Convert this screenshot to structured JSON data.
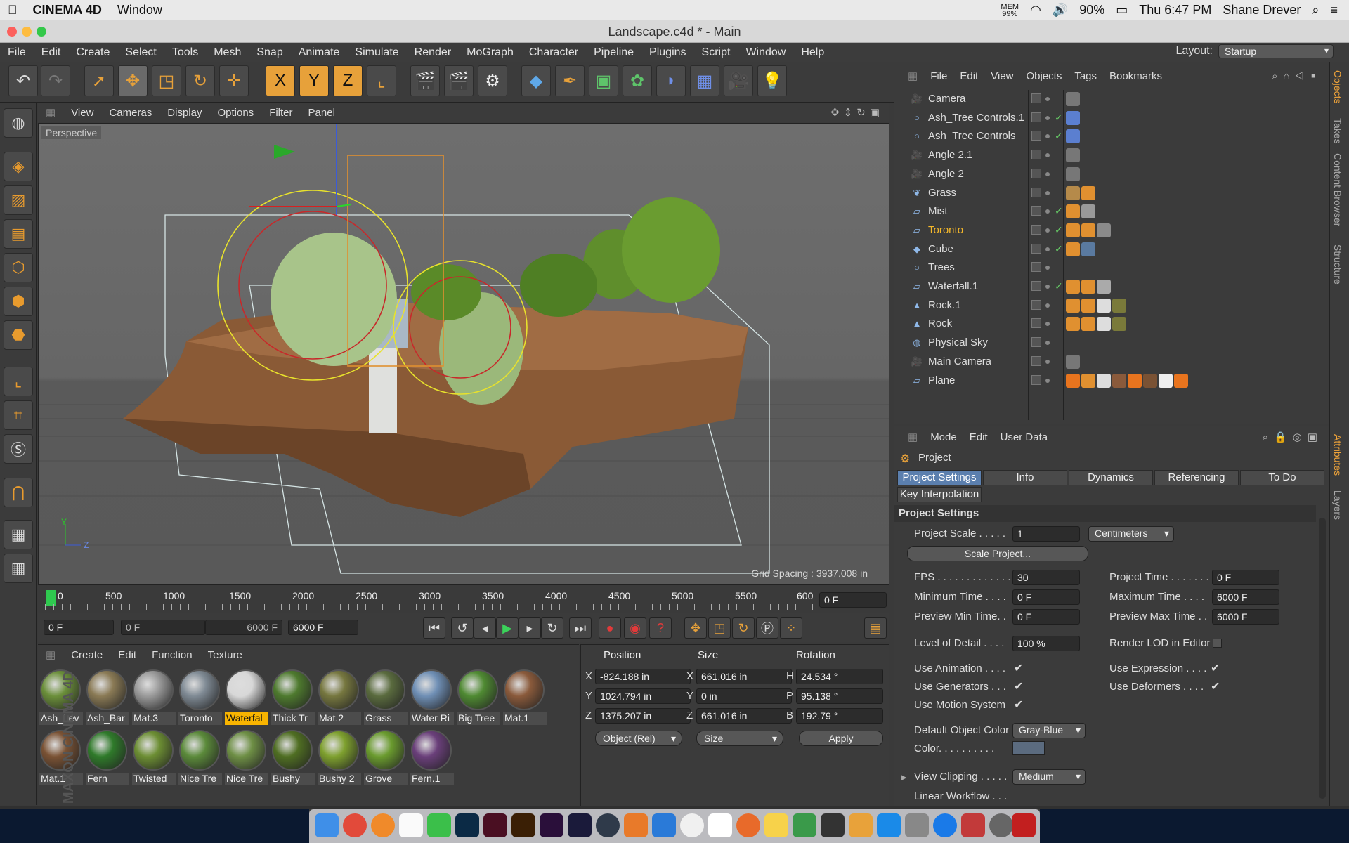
{
  "mac": {
    "app": "CINEMA 4D",
    "menu": [
      "Window"
    ],
    "mem": "MEM",
    "mem_value": "99%",
    "battery": "90%",
    "clock": "Thu 6:47 PM",
    "user": "Shane Drever"
  },
  "window": {
    "title": "Landscape.c4d * - Main"
  },
  "appmenu": {
    "items": [
      "File",
      "Edit",
      "Create",
      "Select",
      "Tools",
      "Mesh",
      "Snap",
      "Animate",
      "Simulate",
      "Render",
      "MoGraph",
      "Character",
      "Pipeline",
      "Plugins",
      "Script",
      "Window",
      "Help"
    ],
    "layout_label": "Layout:",
    "layout_value": "Startup"
  },
  "toolbar": {
    "tools": [
      "undo-icon",
      "redo-icon",
      "select-live-icon",
      "move-icon",
      "scale-icon",
      "rotate-icon",
      "transform-icon",
      "x-axis-icon",
      "y-axis-icon",
      "z-axis-icon",
      "world-coords-icon",
      "render-view-icon",
      "render-picture-viewer-icon",
      "render-settings-icon",
      "cube-icon",
      "pen-icon",
      "subdivision-icon",
      "cloner-icon",
      "deformer-icon",
      "floor-icon",
      "camera-icon",
      "light-icon"
    ],
    "axis_labels": [
      "X",
      "Y",
      "Z"
    ]
  },
  "viewport": {
    "menu": [
      "View",
      "Cameras",
      "Display",
      "Options",
      "Filter",
      "Panel"
    ],
    "label": "Perspective",
    "grid_spacing": "Grid Spacing : 3937.008 in",
    "axis_y": "Y",
    "axis_z": "Z"
  },
  "timeline": {
    "ticks": [
      "0",
      "500",
      "1000",
      "1500",
      "2000",
      "2500",
      "3000",
      "3500",
      "4000",
      "4500",
      "5000",
      "5500",
      "600"
    ],
    "current_frame": "0 F",
    "start": "0 F",
    "range_start": "0 F",
    "range_end": "6000 F",
    "end": "6000 F"
  },
  "materials": {
    "menu": [
      "Create",
      "Edit",
      "Function",
      "Texture"
    ],
    "items": [
      {
        "label": "Ash_Lev",
        "color": "#6b8f3a"
      },
      {
        "label": "Ash_Bar",
        "color": "#8a7a55"
      },
      {
        "label": "Mat.3",
        "color": "#9a9a9a"
      },
      {
        "label": "Toronto",
        "color": "#7f8a94"
      },
      {
        "label": "Waterfal",
        "color": "#d8d8d8"
      },
      {
        "label": "Thick Tr",
        "color": "#4e7a2e"
      },
      {
        "label": "Mat.2",
        "color": "#76773f"
      },
      {
        "label": "Grass",
        "color": "#5a6b3e"
      },
      {
        "label": "Water Ri",
        "color": "#6f8fb5"
      },
      {
        "label": "Big Tree",
        "color": "#4f8a32"
      },
      {
        "label": "Mat.1",
        "color": "#8a5a3b"
      },
      {
        "label": "Mat.1",
        "color": "#7a5234"
      },
      {
        "label": "Fern",
        "color": "#2f7a2a"
      },
      {
        "label": "Twisted",
        "color": "#6c8e33"
      },
      {
        "label": "Nice Tre",
        "color": "#5b8a3a"
      },
      {
        "label": "Nice Tre",
        "color": "#6e8f45"
      },
      {
        "label": "Bushy",
        "color": "#4f6e22"
      },
      {
        "label": "Bushy 2",
        "color": "#7ea02e"
      },
      {
        "label": "Grove",
        "color": "#6a9b2e"
      },
      {
        "label": "Fern.1",
        "color": "#6a3f7a"
      }
    ],
    "active_index": 4
  },
  "coords": {
    "headers": [
      "Position",
      "Size",
      "Rotation"
    ],
    "position": [
      {
        "axis": "X",
        "value": "-824.188 in"
      },
      {
        "axis": "Y",
        "value": "1024.794 in"
      },
      {
        "axis": "Z",
        "value": "1375.207 in"
      }
    ],
    "size": [
      {
        "axis": "X",
        "value": "661.016 in"
      },
      {
        "axis": "Y",
        "value": "0 in"
      },
      {
        "axis": "Z",
        "value": "661.016 in"
      }
    ],
    "rotation": [
      {
        "axis": "H",
        "value": "24.534 °"
      },
      {
        "axis": "P",
        "value": "95.138 °"
      },
      {
        "axis": "B",
        "value": "192.79 °"
      }
    ],
    "mode": "Object (Rel)",
    "size_mode": "Size",
    "apply": "Apply"
  },
  "objects": {
    "menu": [
      "File",
      "Edit",
      "View",
      "Objects",
      "Tags",
      "Bookmarks"
    ],
    "rows": [
      {
        "name": "Camera",
        "icon": "camera-icon",
        "check": false,
        "tags": [
          "#777"
        ]
      },
      {
        "name": "Ash_Tree Controls.1",
        "icon": "null-icon",
        "check": true,
        "tags": [
          "#5b7fd0"
        ]
      },
      {
        "name": "Ash_Tree Controls",
        "icon": "null-icon",
        "check": true,
        "tags": [
          "#5b7fd0"
        ]
      },
      {
        "name": "Angle 2.1",
        "icon": "camera-icon",
        "check": false,
        "tags": [
          "#777"
        ]
      },
      {
        "name": "Angle 2",
        "icon": "camera-icon",
        "check": false,
        "tags": [
          "#777"
        ]
      },
      {
        "name": "Grass",
        "icon": "grass-icon",
        "check": false,
        "tags": [
          "#b58a4a",
          "#e09030"
        ]
      },
      {
        "name": "Mist",
        "icon": "plane-icon",
        "check": true,
        "tags": [
          "#e09030",
          "#999"
        ]
      },
      {
        "name": "Toronto",
        "icon": "plane-icon",
        "check": true,
        "tags": [
          "#e09030",
          "#e09030",
          "#8a8a8a"
        ]
      },
      {
        "name": "Cube",
        "icon": "cube-icon",
        "check": true,
        "tags": [
          "#e09030",
          "#5a7aa0"
        ]
      },
      {
        "name": "Trees",
        "icon": "null-icon",
        "check": false,
        "tags": []
      },
      {
        "name": "Waterfall.1",
        "icon": "plane-icon",
        "check": true,
        "tags": [
          "#e09030",
          "#e09030",
          "#aaa"
        ]
      },
      {
        "name": "Rock.1",
        "icon": "rock-icon",
        "check": false,
        "tags": [
          "#e09030",
          "#e09030",
          "#ddd",
          "#7a7a3a"
        ]
      },
      {
        "name": "Rock",
        "icon": "rock-icon",
        "check": false,
        "tags": [
          "#e09030",
          "#e09030",
          "#ddd",
          "#7a7a3a"
        ]
      },
      {
        "name": "Physical Sky",
        "icon": "sky-icon",
        "check": false,
        "tags": []
      },
      {
        "name": "Main Camera",
        "icon": "camera-icon",
        "check": false,
        "tags": [
          "#777"
        ]
      },
      {
        "name": "Plane",
        "icon": "plane-icon",
        "check": false,
        "tags": [
          "#e8741e",
          "#e09030",
          "#ddd",
          "#8a5a3b",
          "#e8741e",
          "#7a5234",
          "#eee",
          "#e8741e"
        ]
      }
    ],
    "active_row": "Toronto"
  },
  "right_tabs": [
    "Objects",
    "Takes",
    "Content Browser",
    "Structure",
    "Attributes",
    "Layers"
  ],
  "attributes": {
    "menu": [
      "Mode",
      "Edit",
      "User Data"
    ],
    "object_name": "Project",
    "tabs": [
      "Project Settings",
      "Info",
      "Dynamics",
      "Referencing",
      "To Do"
    ],
    "tab2": "Key Interpolation",
    "section": "Project Settings",
    "project_scale_label": "Project Scale . . . . .",
    "project_scale": "1",
    "project_scale_unit": "Centimeters",
    "scale_project": "Scale Project...",
    "fps_label": "FPS . . . . . . . . . . . . .",
    "fps": "30",
    "min_time_label": "Minimum Time . . . .",
    "min_time": "0 F",
    "preview_min_label": "Preview Min Time. .",
    "preview_min": "0 F",
    "project_time_label": "Project Time . . . . . . .",
    "project_time": "0 F",
    "max_time_label": "Maximum Time . . . .",
    "max_time": "6000 F",
    "preview_max_label": "Preview Max Time . .",
    "preview_max": "6000 F",
    "lod_label": "Level of Detail . . . .",
    "lod": "100 %",
    "render_lod_label": "Render LOD in Editor",
    "use_animation": "Use Animation . . . .",
    "use_generators": "Use Generators . . .",
    "use_motion": "Use Motion System",
    "use_expression": "Use Expression . . . .",
    "use_deformers": "Use Deformers . . . .",
    "default_color_label": "Default Object Color",
    "default_color": "Gray-Blue",
    "color_label": "Color. . . . . . . . . .",
    "view_clipping_label": "View Clipping . . . . .",
    "view_clipping": "Medium",
    "linear_workflow": "Linear Workflow . . ."
  },
  "brand": "MAXON CINEMA 4D"
}
